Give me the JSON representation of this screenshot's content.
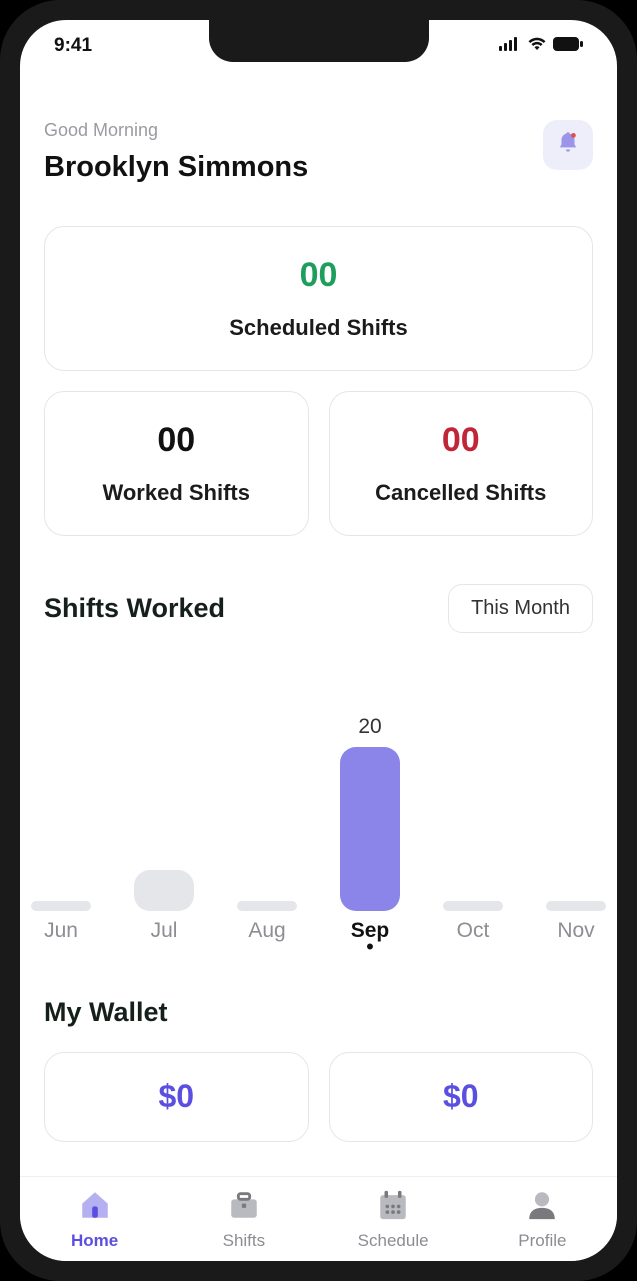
{
  "status_bar": {
    "time": "9:41"
  },
  "header": {
    "greeting": "Good Morning",
    "username": "Brooklyn Simmons"
  },
  "stats": {
    "scheduled": {
      "value": "00",
      "label": "Scheduled Shifts"
    },
    "worked": {
      "value": "00",
      "label": "Worked Shifts"
    },
    "cancelled": {
      "value": "00",
      "label": "Cancelled Shifts"
    }
  },
  "shifts_section": {
    "title": "Shifts Worked",
    "filter_label": "This Month"
  },
  "chart_data": {
    "type": "bar",
    "categories": [
      "Jun",
      "Jul",
      "Aug",
      "Sep",
      "Oct",
      "Nov"
    ],
    "values": [
      1,
      5,
      1,
      20,
      1,
      1
    ],
    "highlight_index": 3,
    "highlight_value_label": "20",
    "ylim": [
      0,
      22
    ],
    "title": "Shifts Worked",
    "xlabel": "",
    "ylabel": ""
  },
  "wallet": {
    "title": "My Wallet",
    "left_value": "$0",
    "right_value": "$0"
  },
  "tabs": {
    "home": "Home",
    "shifts": "Shifts",
    "schedule": "Schedule",
    "profile": "Profile"
  }
}
